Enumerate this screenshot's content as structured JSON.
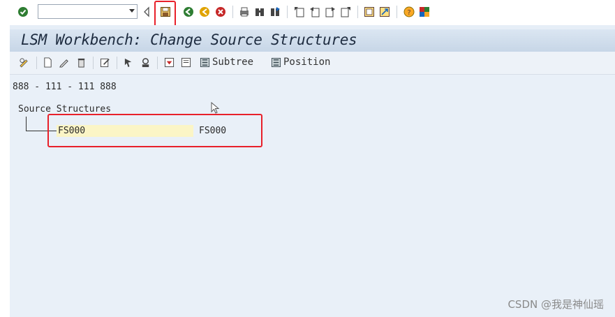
{
  "window": {
    "title": "LSM Workbench: Change Source Structures"
  },
  "system_toolbar": {
    "command_field_value": "",
    "icons": [
      "enter-icon",
      "back-nav-icon",
      "save-icon",
      "back-icon",
      "exit-icon",
      "cancel-icon",
      "print-icon",
      "find-icon",
      "find-next-icon",
      "first-page-icon",
      "prev-page-icon",
      "next-page-icon",
      "last-page-icon",
      "new-session-icon",
      "shortcut-icon",
      "help-icon",
      "layout-icon"
    ]
  },
  "app_toolbar": {
    "subtree_label": "Subtree",
    "position_label": "Position"
  },
  "content": {
    "object_path": "888 - 111 - 111 888",
    "tree_root_label": "Source Structures",
    "node": {
      "name": "FS000",
      "description": "FS000"
    }
  },
  "watermark": "CSDN @我是神仙瑶",
  "colors": {
    "highlight_red": "#e8202a",
    "node_field_bg": "#fbf5c6",
    "title_bar": "#c7d6e7"
  }
}
